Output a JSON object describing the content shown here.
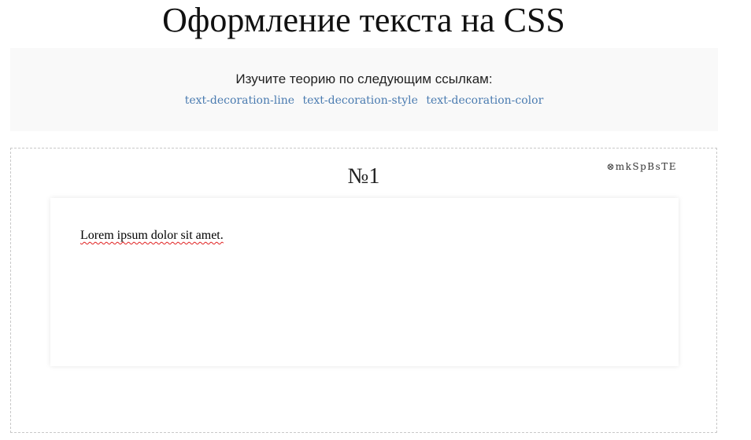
{
  "page": {
    "title": "Оформление текста на CSS"
  },
  "theory": {
    "intro": "Изучите теорию по следующим ссылкам:",
    "links": [
      {
        "label": "text-decoration-line"
      },
      {
        "label": "text-decoration-style"
      },
      {
        "label": "text-decoration-color"
      }
    ]
  },
  "task": {
    "number": "№1",
    "id_icon": "circled-x-icon",
    "id": "mkSpBsTE",
    "preview_text": "Lorem ipsum dolor sit amet.",
    "underline_color": "#e02020",
    "underline_style": "wavy"
  },
  "colors": {
    "link": "#4a7bb0",
    "theory_background": "#f9f9f9"
  }
}
